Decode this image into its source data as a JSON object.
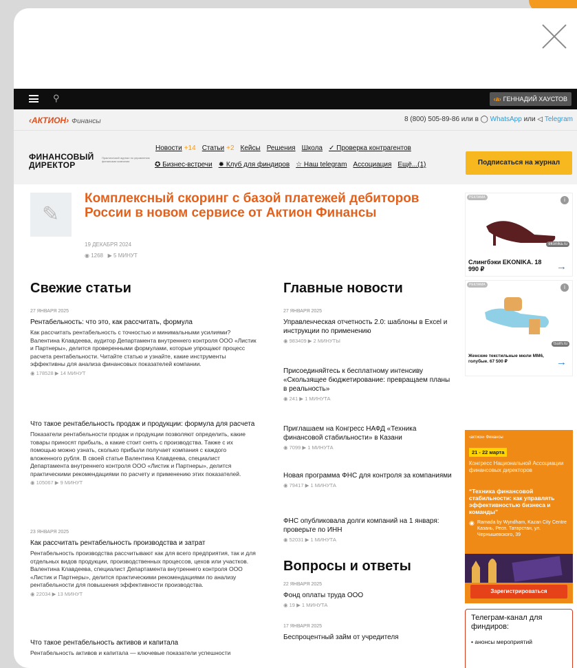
{
  "header": {
    "user": "ГЕННАДИЙ ХАУСТОВ",
    "user_mark": "‹a›"
  },
  "brand": {
    "name": "‹АКТИОН›",
    "section": "Финансы"
  },
  "contacts": {
    "phone": "8 (800) 505-89-86 или в",
    "whatsapp": "WhatsApp",
    "or": "или",
    "telegram": "Telegram"
  },
  "logo": {
    "line1": "ФИНАНСОВЫЙ",
    "line2": "ДИРЕКТОР",
    "sub": "Практический журнал по управлению финансами компании"
  },
  "nav": {
    "row1": [
      {
        "label": "Новости",
        "count": "+14"
      },
      {
        "label": "Статьи",
        "count": "+2"
      },
      {
        "label": "Кейсы",
        "count": ""
      },
      {
        "label": "Решения",
        "count": ""
      },
      {
        "label": "Школа",
        "count": ""
      },
      {
        "label": "✓ Проверка контрагентов",
        "count": ""
      }
    ],
    "row2": [
      "✪ Бизнес-встречи",
      "✹ Клуб для финдиров",
      "☆ Наш telegram",
      "Ассоциация",
      "Ещё...(1)"
    ]
  },
  "subscribe": "Подписаться на журнал",
  "featured": {
    "title": "Комплексный скоринг с базой платежей дебиторов России в новом сервисе от Актион Финансы",
    "date": "19 ДЕКАБРЯ 2024",
    "views": "1268",
    "time": "5 МИНУТ"
  },
  "fresh": {
    "heading": "Свежие статьи",
    "items": [
      {
        "date": "27 ЯНВАРЯ 2025",
        "title": "Рентабельность: что это, как рассчитать, формула",
        "desc": "Как рассчитать рентабельность с точностью и минимальными усилиями? Валентина Клавдеева, аудитор Департамента внутреннего контроля ООО «Листик и Партнеры», делится проверенными формулами, которые упрощают процесс расчета рентабельности. Читайте статью и узнайте, какие инструменты эффективны для анализа финансовых показателей компании.",
        "views": "178528",
        "time": "14 МИНУТ"
      },
      {
        "date": "",
        "title": "Что такое рентабельность продаж и продукции: формула для расчета",
        "desc": "Показатели рентабельности продаж и продукции позволяют определить, какие товары приносят прибыль, а какие стоит снять с производства. Также с их помощью можно узнать, сколько прибыли получает компания с каждого вложенного рубля. В своей статье Валентина Клавдеева, специалист Департамента внутреннего контроля ООО «Листик и Партнеры», делится практическими рекомендациями по расчету и применению этих показателей.",
        "views": "105067",
        "time": "9 МИНУТ"
      },
      {
        "date": "23 ЯНВАРЯ 2025",
        "title": "Как рассчитать рентабельность производства и затрат",
        "desc": "Рентабельность производства рассчитывают как для всего предприятия, так и для отдельных видов продукции, производственных процессов, цехов или участков. Валентина Клавдеева, специалист Департамента внутреннего контроля ООО «Листик и Партнеры», делится практическими рекомендациями по анализу рентабельности для повышения эффективности производства.",
        "views": "22034",
        "time": "13 МИНУТ"
      },
      {
        "date": "",
        "title": "Что такое рентабельность активов и капитала",
        "desc": "Рентабельность активов и капитала — ключевые показатели успешности",
        "views": "",
        "time": ""
      }
    ]
  },
  "news": {
    "heading": "Главные новости",
    "items": [
      {
        "date": "27 ЯНВАРЯ 2025",
        "title": "Управленческая отчетность 2.0: шаблоны в Excel и инструкции по применению",
        "views": "983409",
        "time": "2 МИНУТЫ"
      },
      {
        "date": "",
        "title": "Присоединяйтесь к бесплатному интенсиву «Скользящее бюджетирование: превращаем планы в реальность»",
        "views": "241",
        "time": "1 МИНУТА"
      },
      {
        "date": "",
        "title": "Приглашаем на Конгресс НАФД «Техника финансовой стабильности» в Казани",
        "views": "7099",
        "time": "1 МИНУТА"
      },
      {
        "date": "",
        "title": "Новая программа ФНС для контроля за компаниями",
        "views": "79417",
        "time": "1 МИНУТА"
      },
      {
        "date": "",
        "title": "ФНС опубликовала долги компаний на 1 января: проверьте по ИНН",
        "views": "52031",
        "time": "1 МИНУТА"
      }
    ]
  },
  "qa": {
    "heading": "Вопросы и ответы",
    "items": [
      {
        "date": "22 ЯНВАРЯ 2025",
        "title": "Фонд оплаты труда ООО",
        "views": "19",
        "time": "1 МИНУТА"
      },
      {
        "date": "17 ЯНВАРЯ 2025",
        "title": "Беспроцентный займ от учредителя",
        "views": "",
        "time": ""
      }
    ]
  },
  "ads": [
    {
      "badge": "РЕКЛАМА",
      "source": "ekonika.ru",
      "title": "Слингбэки EKONIKA. 18 990 ₽",
      "colors": {
        "shoe": "#5b1f22"
      }
    },
    {
      "badge": "РЕКЛАМА",
      "source": "tsum.ru",
      "title": "Женские текстильные мюли ММ6, голубые. 67 500 ₽",
      "colors": {
        "shoe": "#8fd0e6"
      }
    }
  ],
  "banner": {
    "org": "‹актион› Финансы",
    "dates": "21 - 22 марта",
    "line1": "Конгресс Национальной Ассоциации финансовых директоров",
    "line2": "“Техника финансовой стабильности: как управлять эффективностью бизнеса и команды”",
    "place": "Ramada by Wyndham, Kazan City Centre Казань, Респ. Татарстан, ул. Чернышевского, 39",
    "register": "Зарегистрироваться"
  },
  "telegram": {
    "title": "Телеграм-канал для финдиров:",
    "bullet": "анонсы мероприятий"
  }
}
